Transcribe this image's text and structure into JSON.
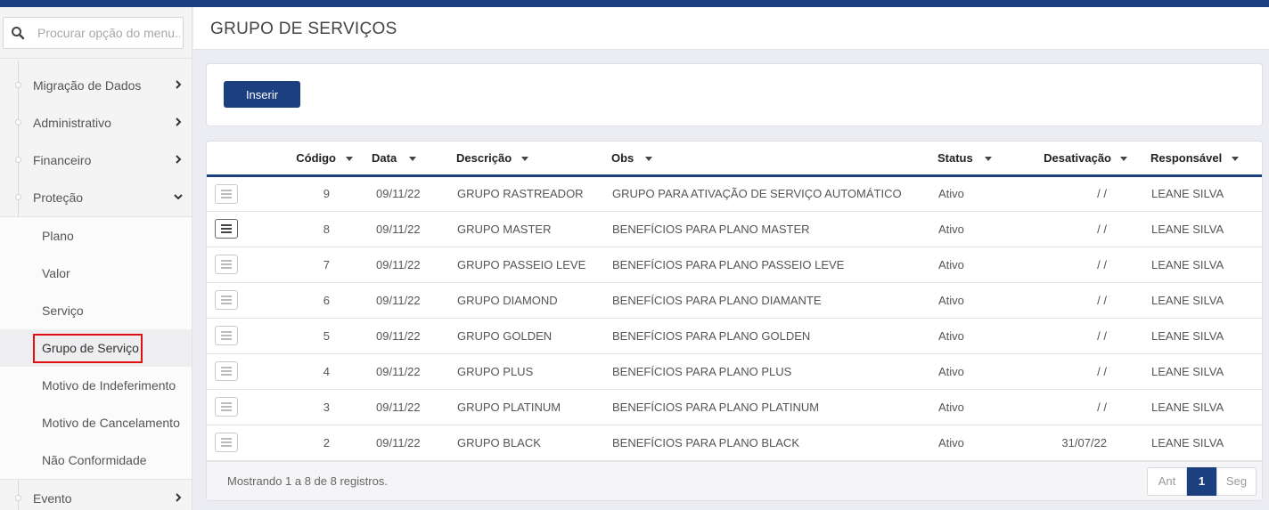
{
  "search": {
    "placeholder": "Procurar opção do menu..."
  },
  "sidebar": {
    "items": [
      {
        "label": "Migração de Dados",
        "expanded": false
      },
      {
        "label": "Administrativo",
        "expanded": false
      },
      {
        "label": "Financeiro",
        "expanded": false
      },
      {
        "label": "Proteção",
        "expanded": true
      }
    ],
    "subitems": [
      {
        "label": "Plano"
      },
      {
        "label": "Valor"
      },
      {
        "label": "Serviço"
      },
      {
        "label": "Grupo de Serviço",
        "active": true
      },
      {
        "label": "Motivo de Indeferimento"
      },
      {
        "label": "Motivo de Cancelamento"
      },
      {
        "label": "Não Conformidade"
      }
    ],
    "after": [
      {
        "label": "Evento",
        "expanded": false
      }
    ]
  },
  "header": {
    "title": "GRUPO DE SERVIÇOS"
  },
  "toolbar": {
    "insert_label": "Inserir"
  },
  "table": {
    "columns": [
      "Código",
      "Data",
      "Descrição",
      "Obs",
      "Status",
      "Desativação",
      "Responsável"
    ],
    "rows": [
      {
        "codigo": "9",
        "data": "09/11/22",
        "descricao": "GRUPO RASTREADOR",
        "obs": "GRUPO PARA ATIVAÇÃO DE SERVIÇO AUTOMÁTICO",
        "status": "Ativo",
        "desativacao": "/ /",
        "responsavel": "LEANE SILVA"
      },
      {
        "codigo": "8",
        "data": "09/11/22",
        "descricao": "GRUPO MASTER",
        "obs": "BENEFÍCIOS PARA PLANO MASTER",
        "status": "Ativo",
        "desativacao": "/ /",
        "responsavel": "LEANE SILVA"
      },
      {
        "codigo": "7",
        "data": "09/11/22",
        "descricao": "GRUPO PASSEIO LEVE",
        "obs": "BENEFÍCIOS PARA PLANO PASSEIO LEVE",
        "status": "Ativo",
        "desativacao": "/ /",
        "responsavel": "LEANE SILVA"
      },
      {
        "codigo": "6",
        "data": "09/11/22",
        "descricao": "GRUPO DIAMOND",
        "obs": "BENEFÍCIOS PARA PLANO DIAMANTE",
        "status": "Ativo",
        "desativacao": "/ /",
        "responsavel": "LEANE SILVA"
      },
      {
        "codigo": "5",
        "data": "09/11/22",
        "descricao": "GRUPO GOLDEN",
        "obs": "BENEFÍCIOS PARA PLANO GOLDEN",
        "status": "Ativo",
        "desativacao": "/ /",
        "responsavel": "LEANE SILVA"
      },
      {
        "codigo": "4",
        "data": "09/11/22",
        "descricao": "GRUPO PLUS",
        "obs": "BENEFÍCIOS PARA PLANO PLUS",
        "status": "Ativo",
        "desativacao": "/ /",
        "responsavel": "LEANE SILVA"
      },
      {
        "codigo": "3",
        "data": "09/11/22",
        "descricao": "GRUPO PLATINUM",
        "obs": "BENEFÍCIOS PARA PLANO PLATINUM",
        "status": "Ativo",
        "desativacao": "/ /",
        "responsavel": "LEANE SILVA"
      },
      {
        "codigo": "2",
        "data": "09/11/22",
        "descricao": "GRUPO BLACK",
        "obs": "BENEFÍCIOS PARA PLANO BLACK",
        "status": "Ativo",
        "desativacao": "31/07/22",
        "responsavel": "LEANE SILVA"
      }
    ]
  },
  "footer": {
    "info": "Mostrando 1 a 8 de 8 registros.",
    "pagination": {
      "prev": "Ant",
      "current": "1",
      "next": "Seg"
    }
  },
  "colors": {
    "brand": "#1c3f7f",
    "highlight": "#e01010"
  }
}
